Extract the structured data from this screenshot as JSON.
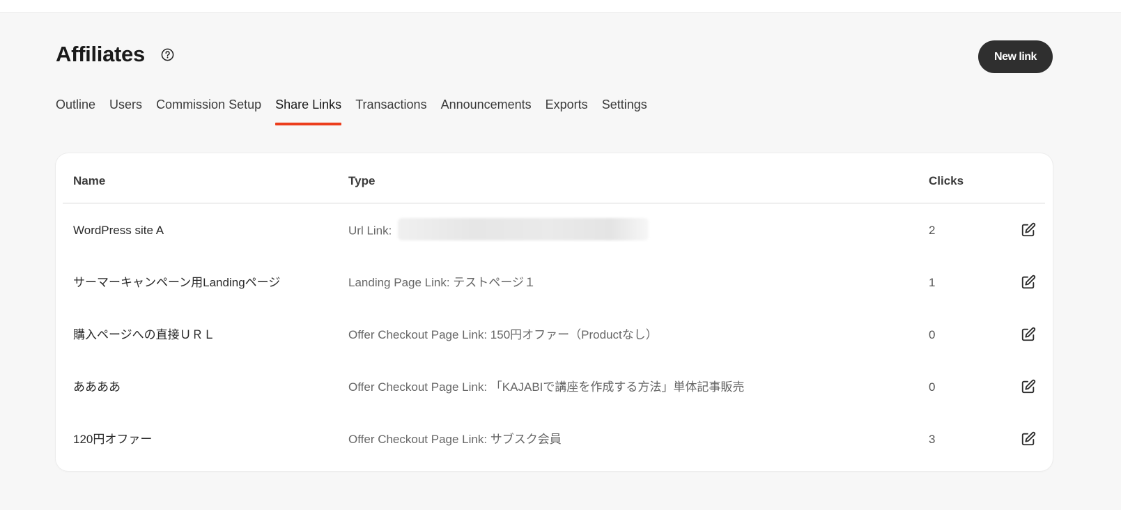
{
  "page": {
    "title": "Affiliates",
    "new_link_label": "New link"
  },
  "tabs": [
    {
      "label": "Outline",
      "active": false
    },
    {
      "label": "Users",
      "active": false
    },
    {
      "label": "Commission Setup",
      "active": false
    },
    {
      "label": "Share Links",
      "active": true
    },
    {
      "label": "Transactions",
      "active": false
    },
    {
      "label": "Announcements",
      "active": false
    },
    {
      "label": "Exports",
      "active": false
    },
    {
      "label": "Settings",
      "active": false
    }
  ],
  "table": {
    "headers": {
      "name": "Name",
      "type": "Type",
      "clicks": "Clicks"
    },
    "rows": [
      {
        "name": "WordPress site A",
        "type": "Url Link:",
        "type_value_redacted": true,
        "clicks": "2"
      },
      {
        "name": "サーマーキャンペーン用Landingページ",
        "type": "Landing Page Link: テストページ１",
        "clicks": "1"
      },
      {
        "name": "購入ページへの直接ＵＲＬ",
        "type": "Offer Checkout Page Link: 150円オファー（Productなし）",
        "clicks": "0"
      },
      {
        "name": "ああああ",
        "type": "Offer Checkout Page Link: 「KAJABIで講座を作成する方法」単体記事販売",
        "clicks": "0"
      },
      {
        "name": "120円オファー",
        "type": "Offer Checkout Page Link: サブスク会員",
        "clicks": "3"
      }
    ]
  },
  "colors": {
    "accent": "#ec3d1c",
    "button_bg": "#2f2f2f",
    "background": "#f7f7f7"
  },
  "icons": {
    "help": "help-circle-icon",
    "edit": "edit-icon"
  }
}
